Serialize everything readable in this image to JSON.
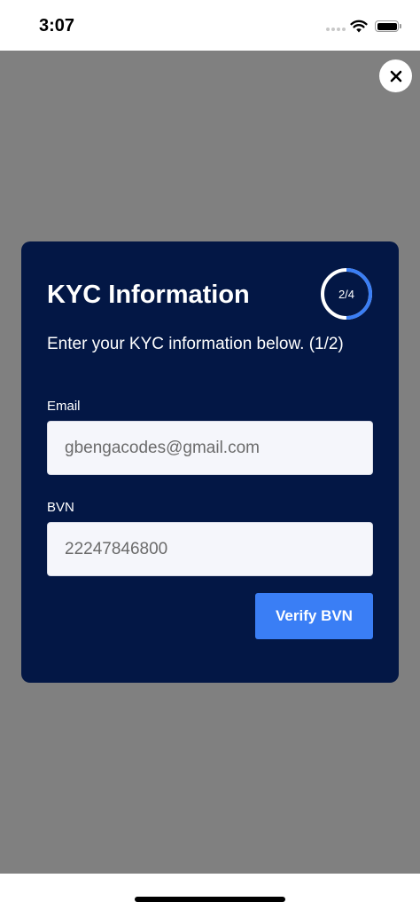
{
  "status_bar": {
    "time": "3:07"
  },
  "icons": {
    "close": "close-icon",
    "wifi": "wifi-icon",
    "battery": "battery-icon"
  },
  "colors": {
    "overlay": "#808080",
    "card_background": "#031745",
    "accent": "#3a7ef5",
    "input_background": "#f5f6fb"
  },
  "card": {
    "title": "KYC Information",
    "step_indicator": "2/4",
    "step_progress": 0.5,
    "subtitle": "Enter your KYC information below. (1/2)",
    "email_label": "Email",
    "email_value": "gbengacodes@gmail.com",
    "bvn_label": "BVN",
    "bvn_value": "22247846800",
    "verify_button_label": "Verify BVN"
  }
}
